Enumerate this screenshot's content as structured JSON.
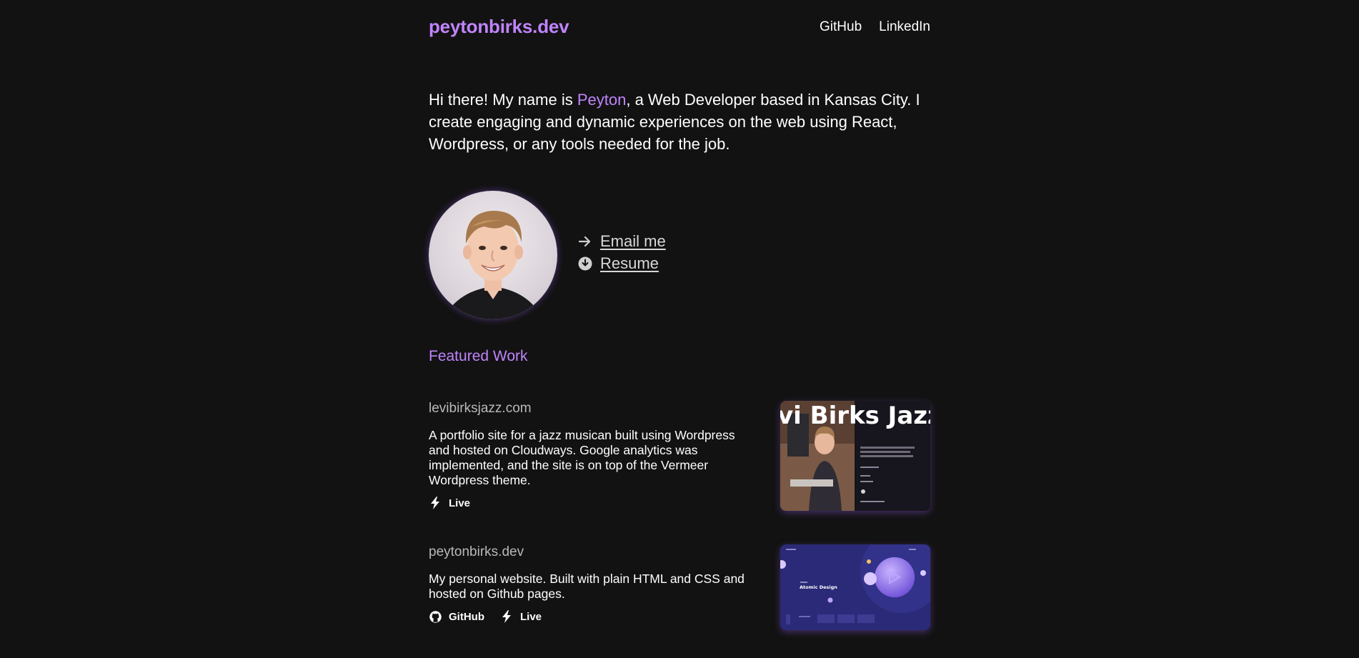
{
  "header": {
    "logo": "peytonbirks.dev",
    "nav": [
      {
        "label": "GitHub"
      },
      {
        "label": "LinkedIn"
      }
    ]
  },
  "intro": {
    "before": "Hi there! My name is ",
    "name": "Peyton",
    "after": ", a Web Developer based in Kansas City. I create engaging and dynamic experiences on the web using React, Wordpress, or any tools needed for the job."
  },
  "profile": {
    "email_label": "Email me",
    "resume_label": "Resume"
  },
  "featured": {
    "title": "Featured Work",
    "projects": [
      {
        "title": "levibirksjazz.com",
        "description": "A portfolio site for a jazz musican built using Wordpress and hosted on Cloudways. Google analytics was implemented, and the site is on top of the Vermeer Wordpress theme.",
        "links": [
          {
            "label": "Live",
            "icon": "bolt-icon"
          }
        ],
        "thumbnail_text": "vi Birks Jazz"
      },
      {
        "title": "peytonbirks.dev",
        "description": "My personal website. Built with plain HTML and CSS and hosted on Github pages.",
        "links": [
          {
            "label": "GitHub",
            "icon": "github-icon"
          },
          {
            "label": "Live",
            "icon": "bolt-icon"
          }
        ],
        "thumbnail_text": "Atomic Design"
      }
    ]
  },
  "colors": {
    "background": "#121212",
    "accent": "#c084fc",
    "text": "#ffffff",
    "muted": "#b9b9b9"
  }
}
